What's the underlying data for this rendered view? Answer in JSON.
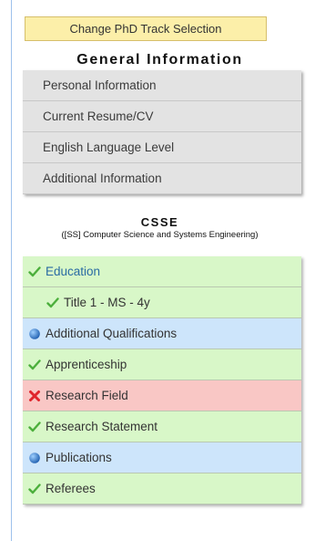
{
  "track_button": {
    "label": "Change PhD Track Selection"
  },
  "general": {
    "title": "General Information",
    "items": [
      {
        "label": "Personal Information"
      },
      {
        "label": "Current Resume/CV"
      },
      {
        "label": "English Language Level"
      },
      {
        "label": "Additional Information"
      }
    ]
  },
  "program": {
    "title": "CSSE",
    "subtitle": "([SS] Computer Science and Systems Engineering)",
    "items": [
      {
        "label": "Education",
        "status": "done",
        "icon": "check-icon"
      },
      {
        "label": "Title 1 - MS - 4y",
        "status": "done",
        "icon": "check-icon"
      },
      {
        "label": "Additional Qualifications",
        "status": "info",
        "icon": "blue-dot-icon"
      },
      {
        "label": "Apprenticeship",
        "status": "done",
        "icon": "check-icon"
      },
      {
        "label": "Research Field",
        "status": "error",
        "icon": "x-icon"
      },
      {
        "label": "Research Statement",
        "status": "done",
        "icon": "check-icon"
      },
      {
        "label": "Publications",
        "status": "info",
        "icon": "blue-dot-icon"
      },
      {
        "label": "Referees",
        "status": "done",
        "icon": "check-icon"
      }
    ]
  },
  "colors": {
    "done": "#d8f7c8",
    "info": "#cde5fb",
    "error": "#f9c7c5",
    "button_bg": "#fcefa9"
  }
}
